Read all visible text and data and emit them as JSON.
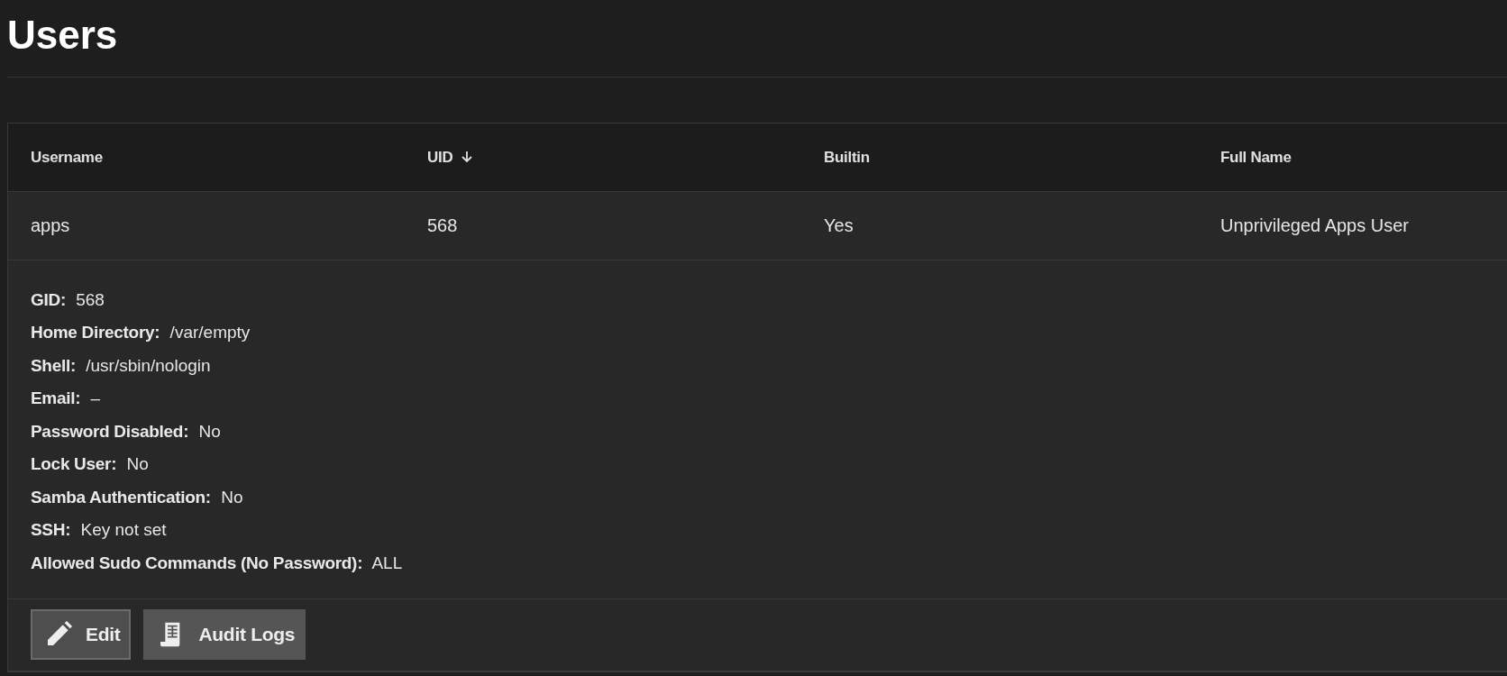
{
  "page": {
    "title": "Users"
  },
  "table": {
    "columns": [
      {
        "label": "Username",
        "sorted": false
      },
      {
        "label": "UID",
        "sorted": true
      },
      {
        "label": "Builtin",
        "sorted": false
      },
      {
        "label": "Full Name",
        "sorted": false
      }
    ],
    "rows": [
      {
        "cells": [
          "apps",
          "568",
          "Yes",
          "Unprivileged Apps User"
        ],
        "expanded": true,
        "details": [
          {
            "label": "GID:",
            "value": "568"
          },
          {
            "label": "Home Directory:",
            "value": "/var/empty"
          },
          {
            "label": "Shell:",
            "value": "/usr/sbin/nologin"
          },
          {
            "label": "Email:",
            "value": "–"
          },
          {
            "label": "Password Disabled:",
            "value": "No"
          },
          {
            "label": "Lock User:",
            "value": "No"
          },
          {
            "label": "Samba Authentication:",
            "value": "No"
          },
          {
            "label": "SSH:",
            "value": "Key not set"
          },
          {
            "label": "Allowed Sudo Commands (No Password):",
            "value": "ALL"
          }
        ],
        "actions": [
          {
            "label": "Edit",
            "kind": "edit",
            "focused": true
          },
          {
            "label": "Audit Logs",
            "kind": "logs",
            "focused": false
          }
        ]
      }
    ]
  }
}
